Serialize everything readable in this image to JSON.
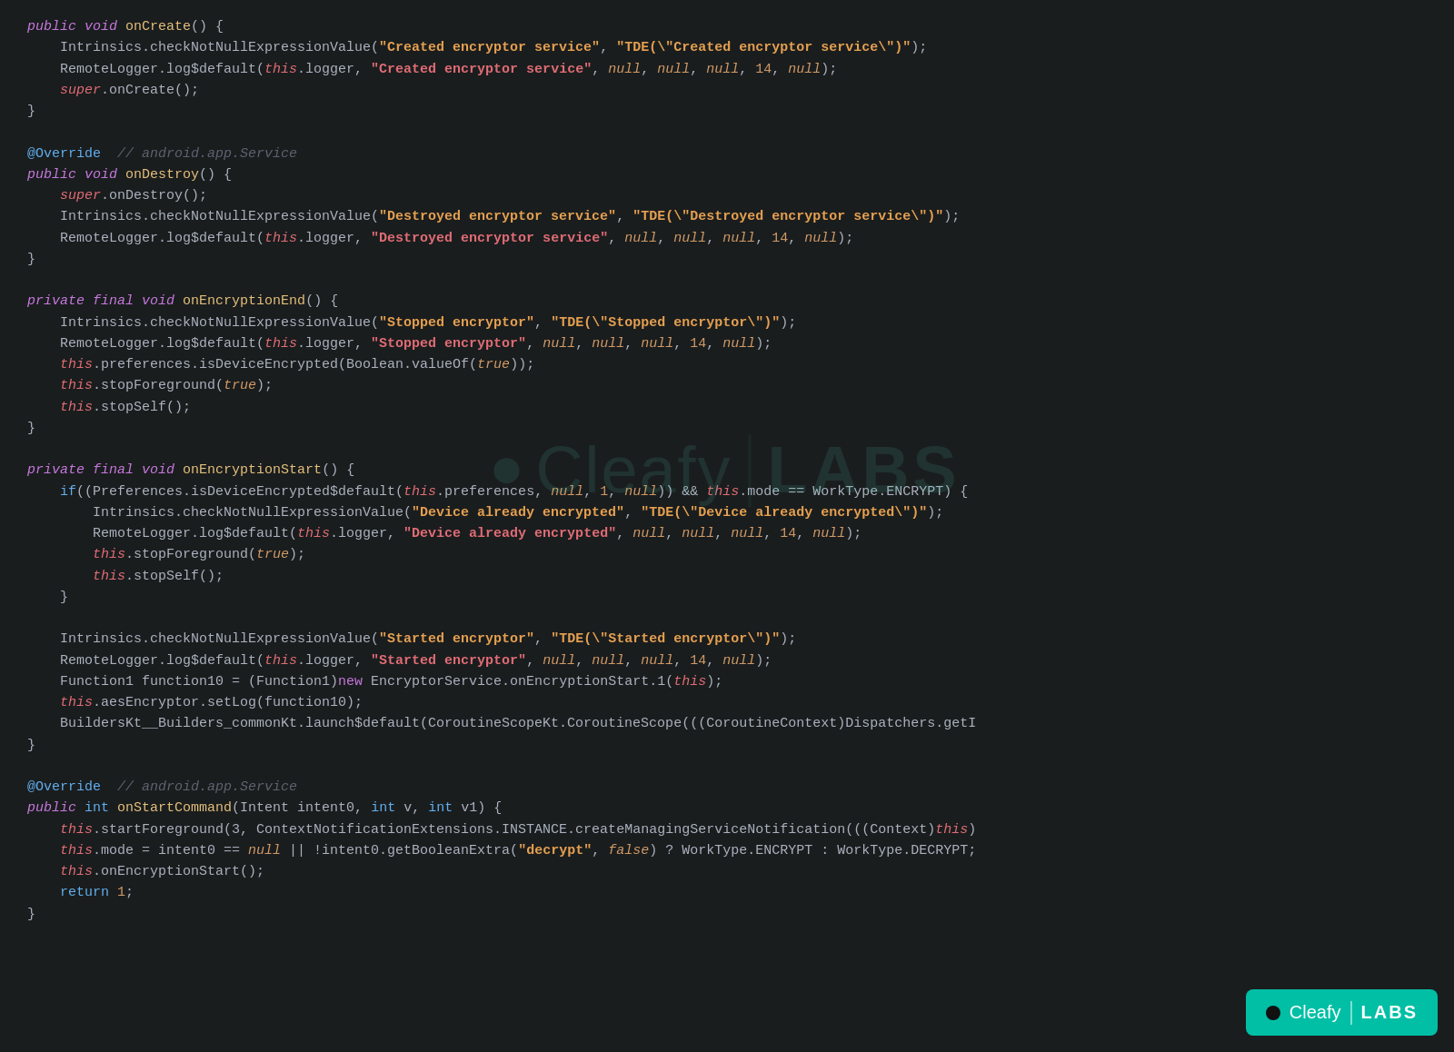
{
  "watermark": {
    "text_cleafy": "Cleafy",
    "text_labs": "LABS"
  },
  "badge": {
    "cleafy": "Cleafy",
    "labs": "LABS"
  }
}
